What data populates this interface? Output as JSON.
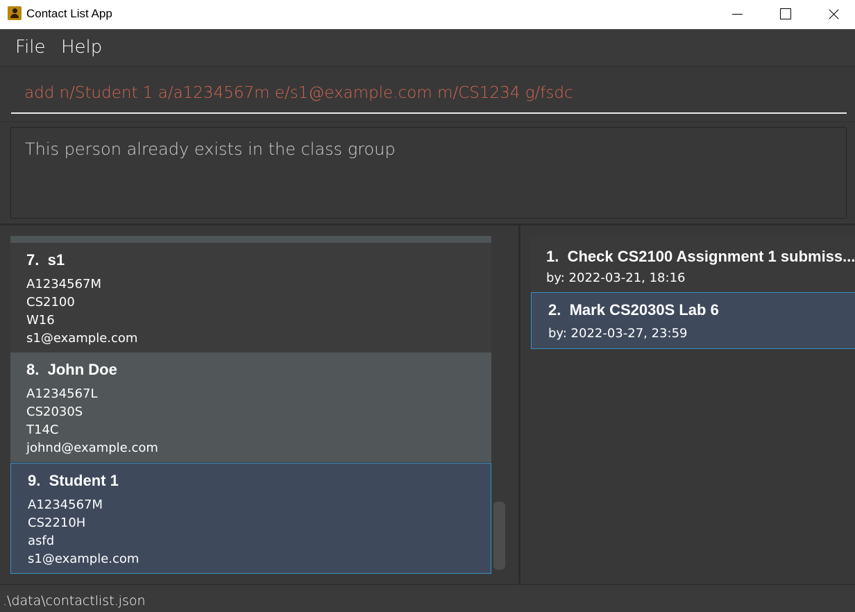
{
  "window": {
    "title": "Contact List App"
  },
  "menu": {
    "items": [
      "File",
      "Help"
    ]
  },
  "command": {
    "value": "add n/Student 1 a/a1234567m e/s1@example.com m/CS1234 g/fsdc"
  },
  "result": {
    "message": "This person already exists in the class group"
  },
  "persons": [
    {
      "index": "7.",
      "name": "s1",
      "student_id": "A1234567M",
      "module": "CS2100",
      "group": "W16",
      "email": "s1@example.com"
    },
    {
      "index": "8.",
      "name": "John Doe",
      "student_id": "A1234567L",
      "module": "CS2030S",
      "group": "T14C",
      "email": "johnd@example.com"
    },
    {
      "index": "9.",
      "name": "Student 1",
      "student_id": "A1234567M",
      "module": "CS2210H",
      "group": "asfd",
      "email": "s1@example.com"
    }
  ],
  "tasks": [
    {
      "index": "1.",
      "title": "Check CS2100 Assignment 1 submiss...",
      "by": "by: 2022-03-21, 18:16"
    },
    {
      "index": "2.",
      "title": "Mark CS2030S Lab 6",
      "by": "by: 2022-03-27, 23:59"
    }
  ],
  "status": {
    "path": ".\\data\\contactlist.json"
  },
  "colors": {
    "command_error_text": "#d06651",
    "selected_card_bg": "#3e4a5c",
    "selected_card_border": "#3b8fc0",
    "hover_card_bg": "#515658"
  }
}
